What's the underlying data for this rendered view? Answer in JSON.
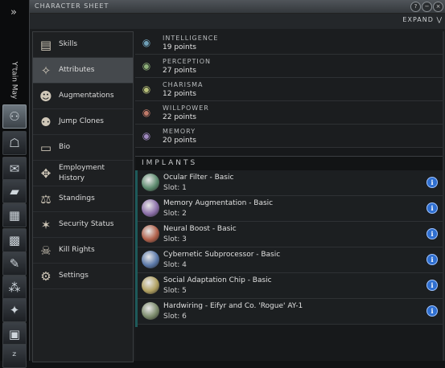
{
  "neocom": {
    "expand_label": "»",
    "character_name": "Y'tain May",
    "buttons": [
      {
        "id": "charsheet",
        "icon": "character-sheet-icon",
        "glyph": "⚇",
        "active": true
      },
      {
        "id": "people",
        "icon": "people-places-icon",
        "glyph": "☖",
        "active": false
      },
      {
        "id": "mail",
        "icon": "mail-icon",
        "glyph": "✉",
        "active": false
      },
      {
        "id": "notepad",
        "icon": "notepad-icon",
        "glyph": "▰",
        "active": false
      },
      {
        "id": "assets",
        "icon": "assets-icon",
        "glyph": "▦",
        "active": false
      },
      {
        "id": "market",
        "icon": "market-icon",
        "glyph": "▩",
        "active": false
      },
      {
        "id": "journal",
        "icon": "journal-icon",
        "glyph": "✎",
        "active": false
      },
      {
        "id": "map",
        "icon": "map-icon",
        "glyph": "⁂",
        "active": false
      },
      {
        "id": "corporation",
        "icon": "corporation-icon",
        "glyph": "✦",
        "active": false
      },
      {
        "id": "fitting",
        "icon": "fitting-icon",
        "glyph": "▣",
        "active": false
      },
      {
        "id": "sleep",
        "icon": "sleep-icon",
        "glyph": "ᶻ",
        "active": false
      }
    ]
  },
  "window": {
    "title": "CHARACTER SHEET",
    "expand_label": "EXPAND",
    "controls": [
      "?",
      "−",
      "×"
    ]
  },
  "nav": {
    "items": [
      {
        "label": "Skills",
        "icon": "skills-book-icon",
        "glyph": "▤",
        "selected": false
      },
      {
        "label": "Attributes",
        "icon": "attributes-icon",
        "glyph": "✧",
        "selected": true
      },
      {
        "label": "Augmentations",
        "icon": "augmentations-icon",
        "glyph": "☻",
        "selected": false
      },
      {
        "label": "Jump Clones",
        "icon": "jump-clones-icon",
        "glyph": "⚉",
        "selected": false
      },
      {
        "label": "Bio",
        "icon": "bio-icon",
        "glyph": "▭",
        "selected": false
      },
      {
        "label": "Employment History",
        "icon": "employment-history-icon",
        "glyph": "✥",
        "selected": false
      },
      {
        "label": "Standings",
        "icon": "standings-icon",
        "glyph": "⚖",
        "selected": false
      },
      {
        "label": "Security Status",
        "icon": "security-status-icon",
        "glyph": "✶",
        "selected": false
      },
      {
        "label": "Kill Rights",
        "icon": "kill-rights-icon",
        "glyph": "☠",
        "selected": false
      },
      {
        "label": "Settings",
        "icon": "settings-icon",
        "glyph": "⚙",
        "selected": false
      }
    ]
  },
  "attributes": [
    {
      "name": "INTELLIGENCE",
      "value": "19 points",
      "icon": "intelligence-icon",
      "color": "#6fa0b8"
    },
    {
      "name": "PERCEPTION",
      "value": "27 points",
      "icon": "perception-icon",
      "color": "#8fb07a"
    },
    {
      "name": "CHARISMA",
      "value": "12 points",
      "icon": "charisma-icon",
      "color": "#b8c07a"
    },
    {
      "name": "WILLPOWER",
      "value": "22 points",
      "icon": "willpower-icon",
      "color": "#c07a6a"
    },
    {
      "name": "MEMORY",
      "value": "20 points",
      "icon": "memory-icon",
      "color": "#a08ac0"
    }
  ],
  "implants_header": "IMPLANTS",
  "implants": [
    {
      "name": "Ocular Filter - Basic",
      "slot": "Slot: 1",
      "icon": "ocular-filter-implant-icon",
      "color": "#5c8a6e"
    },
    {
      "name": "Memory Augmentation - Basic",
      "slot": "Slot: 2",
      "icon": "memory-augmentation-implant-icon",
      "color": "#8a6ea8"
    },
    {
      "name": "Neural Boost - Basic",
      "slot": "Slot: 3",
      "icon": "neural-boost-implant-icon",
      "color": "#b0604a"
    },
    {
      "name": "Cybernetic Subprocessor - Basic",
      "slot": "Slot: 4",
      "icon": "cybernetic-subprocessor-implant-icon",
      "color": "#5a78a8"
    },
    {
      "name": "Social Adaptation Chip - Basic",
      "slot": "Slot: 5",
      "icon": "social-adaptation-chip-implant-icon",
      "color": "#b0a060"
    },
    {
      "name": "Hardwiring - Eifyr and Co. 'Rogue' AY-1",
      "slot": "Slot: 6",
      "icon": "hardwiring-implant-icon",
      "color": "#7a8a6a"
    }
  ],
  "info_glyph": "i"
}
